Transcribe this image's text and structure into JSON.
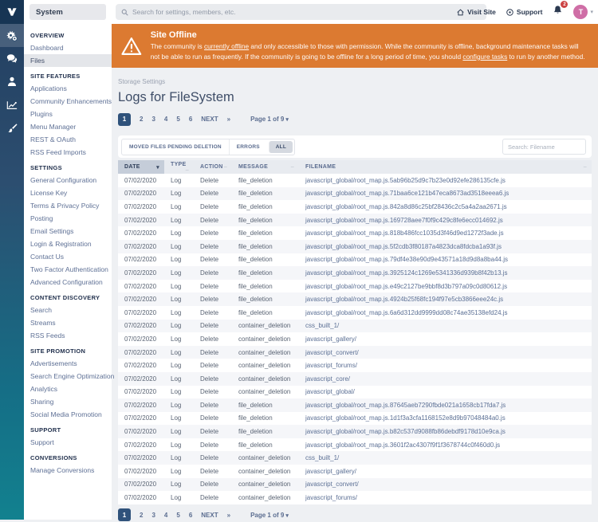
{
  "topbar": {
    "app_title": "System",
    "search_placeholder": "Search for settings, members, etc.",
    "visit_site_label": "Visit Site",
    "support_label": "Support",
    "notification_count": "2",
    "avatar_initial": "T"
  },
  "icon_rail": {
    "items": [
      {
        "name": "system-gears-icon",
        "icon": "gears",
        "active": true
      },
      {
        "name": "community-chat-icon",
        "icon": "chat",
        "active": false
      },
      {
        "name": "members-icon",
        "icon": "person",
        "active": false
      },
      {
        "name": "stats-icon",
        "icon": "chart",
        "active": false
      },
      {
        "name": "customization-icon",
        "icon": "brush",
        "active": false
      }
    ]
  },
  "sidebar": {
    "active_item": "Files",
    "sections": [
      {
        "title": "OVERVIEW",
        "items": [
          "Dashboard",
          "Files"
        ]
      },
      {
        "title": "SITE FEATURES",
        "items": [
          "Applications",
          "Community Enhancements",
          "Plugins",
          "Menu Manager",
          "REST & OAuth",
          "RSS Feed Imports"
        ]
      },
      {
        "title": "SETTINGS",
        "items": [
          "General Configuration",
          "License Key",
          "Terms & Privacy Policy",
          "Posting",
          "Email Settings",
          "Login & Registration",
          "Contact Us",
          "Two Factor Authentication",
          "Advanced Configuration"
        ]
      },
      {
        "title": "CONTENT DISCOVERY",
        "items": [
          "Search",
          "Streams",
          "RSS Feeds"
        ]
      },
      {
        "title": "SITE PROMOTION",
        "items": [
          "Advertisements",
          "Search Engine Optimization",
          "Analytics",
          "Sharing",
          "Social Media Promotion"
        ]
      },
      {
        "title": "SUPPORT",
        "items": [
          "Support"
        ]
      },
      {
        "title": "CONVERSIONS",
        "items": [
          "Manage Conversions"
        ]
      }
    ]
  },
  "banner": {
    "title": "Site Offline",
    "segments": [
      {
        "text": "The community is "
      },
      {
        "text": "currently offline",
        "link": true
      },
      {
        "text": " and only accessible to those with permission. While the community is offline, background maintenance tasks will not be able to run as frequently. If the community is going to be offline for a long period of time, you should "
      },
      {
        "text": "configure tasks",
        "link": true
      },
      {
        "text": " to run by another method."
      }
    ]
  },
  "page": {
    "breadcrumb": "Storage Settings",
    "title": "Logs for FileSystem"
  },
  "pagination": {
    "pages": [
      "1",
      "2",
      "3",
      "4",
      "5",
      "6"
    ],
    "active_page": "1",
    "next_label": "NEXT",
    "last_symbol": "»",
    "page_jump_label": "Page 1 of 9"
  },
  "filters": {
    "tabs": [
      "MOVED FILES PENDING DELETION",
      "ERRORS",
      "ALL"
    ],
    "active_tab": "ALL",
    "search_placeholder": "Search: Filename"
  },
  "table": {
    "columns": [
      "DATE",
      "TYPE",
      "ACTION",
      "MESSAGE",
      "FILENAME"
    ],
    "sorted_column": "DATE",
    "rows": [
      [
        "07/02/2020",
        "Log",
        "Delete",
        "file_deletion",
        "javascript_global/root_map.js.5ab96b25d9c7b23e0d92efe286135cfe.js"
      ],
      [
        "07/02/2020",
        "Log",
        "Delete",
        "file_deletion",
        "javascript_global/root_map.js.71baa6ce121b47eca8673ad3518eeea6.js"
      ],
      [
        "07/02/2020",
        "Log",
        "Delete",
        "file_deletion",
        "javascript_global/root_map.js.842a8d86c25bf28436c2c5a4a2aa2671.js"
      ],
      [
        "07/02/2020",
        "Log",
        "Delete",
        "file_deletion",
        "javascript_global/root_map.js.169728aee7f0f9c429c8fe6ecc014692.js"
      ],
      [
        "07/02/2020",
        "Log",
        "Delete",
        "file_deletion",
        "javascript_global/root_map.js.818b486fcc1035d3f46d9ed1272f3ade.js"
      ],
      [
        "07/02/2020",
        "Log",
        "Delete",
        "file_deletion",
        "javascript_global/root_map.js.5f2cdb3f80187a4823dca8fdcba1a93f.js"
      ],
      [
        "07/02/2020",
        "Log",
        "Delete",
        "file_deletion",
        "javascript_global/root_map.js.79df4e38e90d9e43571a18d9d8a8ba44.js"
      ],
      [
        "07/02/2020",
        "Log",
        "Delete",
        "file_deletion",
        "javascript_global/root_map.js.3925124c1269e5341336d939b8f42b13.js"
      ],
      [
        "07/02/2020",
        "Log",
        "Delete",
        "file_deletion",
        "javascript_global/root_map.js.e49c2127be9bbf8d3b797a09c0d80612.js"
      ],
      [
        "07/02/2020",
        "Log",
        "Delete",
        "file_deletion",
        "javascript_global/root_map.js.4924b25f68fc194f97e5cb3866eee24c.js"
      ],
      [
        "07/02/2020",
        "Log",
        "Delete",
        "file_deletion",
        "javascript_global/root_map.js.6a6d312dd9999dd08c74ae35138efd24.js"
      ],
      [
        "07/02/2020",
        "Log",
        "Delete",
        "container_deletion",
        "css_built_1/"
      ],
      [
        "07/02/2020",
        "Log",
        "Delete",
        "container_deletion",
        "javascript_gallery/"
      ],
      [
        "07/02/2020",
        "Log",
        "Delete",
        "container_deletion",
        "javascript_convert/"
      ],
      [
        "07/02/2020",
        "Log",
        "Delete",
        "container_deletion",
        "javascript_forums/"
      ],
      [
        "07/02/2020",
        "Log",
        "Delete",
        "container_deletion",
        "javascript_core/"
      ],
      [
        "07/02/2020",
        "Log",
        "Delete",
        "container_deletion",
        "javascript_global/"
      ],
      [
        "07/02/2020",
        "Log",
        "Delete",
        "file_deletion",
        "javascript_global/root_map.js.87645aeb7290fbde021a1658cb17fda7.js"
      ],
      [
        "07/02/2020",
        "Log",
        "Delete",
        "file_deletion",
        "javascript_global/root_map.js.1d1f3a3cfa1168152e8d9b97048484a0.js"
      ],
      [
        "07/02/2020",
        "Log",
        "Delete",
        "file_deletion",
        "javascript_global/root_map.js.b82c537d9088fb86debdf9178d10e9ca.js"
      ],
      [
        "07/02/2020",
        "Log",
        "Delete",
        "file_deletion",
        "javascript_global/root_map.js.3601f2ac4307f9f1f3678744c0f460d0.js"
      ],
      [
        "07/02/2020",
        "Log",
        "Delete",
        "container_deletion",
        "css_built_1/"
      ],
      [
        "07/02/2020",
        "Log",
        "Delete",
        "container_deletion",
        "javascript_gallery/"
      ],
      [
        "07/02/2020",
        "Log",
        "Delete",
        "container_deletion",
        "javascript_convert/"
      ],
      [
        "07/02/2020",
        "Log",
        "Delete",
        "container_deletion",
        "javascript_forums/"
      ]
    ]
  },
  "colors": {
    "banner_orange": "#dc7a31",
    "rail_gradient_top": "#223e5f",
    "rail_gradient_bottom": "#12818f",
    "active_page_bg": "#2f527b",
    "avatar_pink": "#cf6ea6",
    "badge_red": "#cc4343",
    "sorted_header_bg": "#c5cdd9"
  }
}
